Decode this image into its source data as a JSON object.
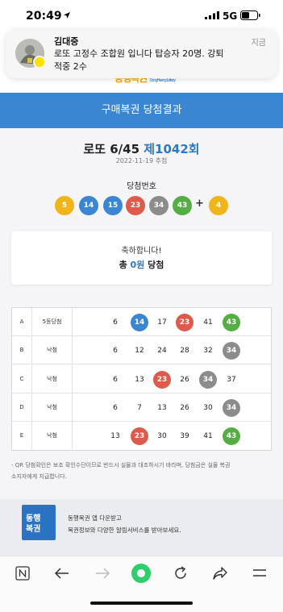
{
  "status_bar": {
    "time": "20:49",
    "network": "5G"
  },
  "notification": {
    "sender": "김대중",
    "time": "지금",
    "line1": "로또 고정수 조합원 입니다 탑승자 20명.  강퇴",
    "line2": "적중 2수"
  },
  "site": {
    "logo": "동행복권",
    "logo_sub": "DongHaeng Lottery"
  },
  "page": {
    "title": "구매복권 당첨결과"
  },
  "draw": {
    "game": "로또 6/45",
    "round": "제1042회",
    "date": "2022-11-19 추첨",
    "winning_label": "당첨번호",
    "winning_numbers": [
      5,
      14,
      15,
      23,
      34,
      43
    ],
    "plus": "+",
    "bonus_number": 4
  },
  "result": {
    "greeting": "축하합니다!",
    "prefix": "총",
    "amount": "0원",
    "suffix": "당첨"
  },
  "tickets": [
    {
      "game": "A",
      "result": "5등당첨",
      "numbers": [
        6,
        14,
        17,
        23,
        41,
        43
      ]
    },
    {
      "game": "B",
      "result": "낙첨",
      "numbers": [
        6,
        12,
        24,
        28,
        32,
        34
      ]
    },
    {
      "game": "C",
      "result": "낙첨",
      "numbers": [
        6,
        13,
        23,
        26,
        34,
        37
      ]
    },
    {
      "game": "D",
      "result": "낙첨",
      "numbers": [
        6,
        7,
        13,
        26,
        30,
        34
      ]
    },
    {
      "game": "E",
      "result": "낙첨",
      "numbers": [
        13,
        23,
        30,
        39,
        41,
        43
      ]
    }
  ],
  "notice": {
    "line1": "- QR 당첨확인은 보조 확인수단이므로 반드시 실물과 대조하시기 바라며, 당첨금은 실물 복권",
    "line2": "소지자에게 지급합니다."
  },
  "app_ad": {
    "logo_line1": "동행",
    "logo_line2": "복권",
    "line1": "동행복권 앱 다운받고",
    "line2": "복권정보와 다양한 알림서비스를 받아보세요."
  },
  "browser_nav": [
    "n-menu-icon",
    "back-arrow-icon",
    "forward-arrow-icon",
    "home-green-icon",
    "reload-icon",
    "share-icon",
    "menu-icon"
  ],
  "colors": {
    "title_bar": "#3b86d2",
    "ball_yellow": "#f0b51a",
    "ball_blue": "#3a86d2",
    "ball_red": "#dd5b4b",
    "ball_gray": "#8c8c8c",
    "ball_green": "#56ad45"
  }
}
